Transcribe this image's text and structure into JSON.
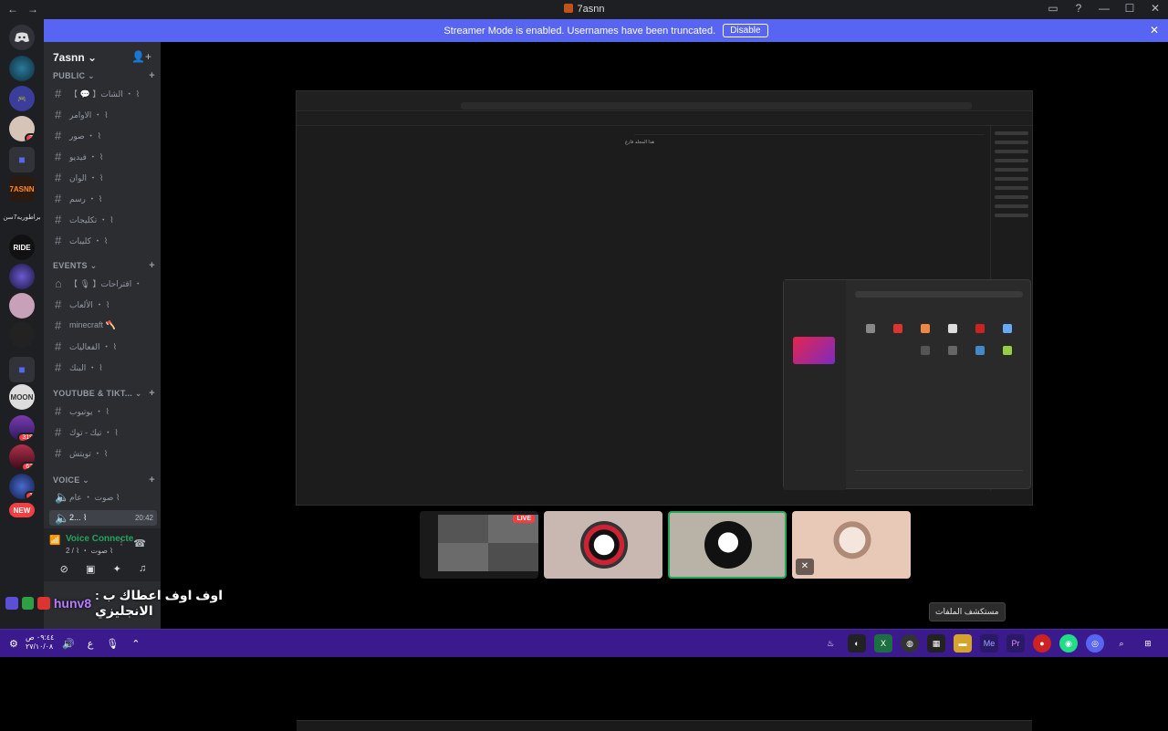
{
  "window": {
    "title": "7asnn",
    "back": "←",
    "forward": "→",
    "help": "?",
    "minimize": "—",
    "maximize": "☐",
    "close": "✕"
  },
  "banner": {
    "text": "Streamer Mode is enabled. Usernames have been truncated.",
    "button": "Disable",
    "close": "✕"
  },
  "guilds": [
    {
      "label": "",
      "badge": ""
    },
    {
      "label": "",
      "badge": ""
    },
    {
      "label": "",
      "badge": "3"
    },
    {
      "label": "",
      "badge": ""
    },
    {
      "label": "7ASNN",
      "badge": ""
    },
    {
      "label": "RIDE",
      "badge": ""
    },
    {
      "label": "",
      "badge": ""
    },
    {
      "label": "",
      "badge": ""
    },
    {
      "label": "",
      "badge": ""
    },
    {
      "label": "MOON",
      "badge": ""
    },
    {
      "label": "",
      "badge": "319"
    },
    {
      "label": "",
      "badge": "62"
    },
    {
      "label": "",
      "badge": "1"
    },
    {
      "label": "NEW",
      "badge": ""
    }
  ],
  "guild_caption": "براطوريه7سن",
  "server": {
    "name": "7asnn ⌄",
    "add_icon": "add-member-icon"
  },
  "categories": {
    "public": "PUBLIC ⌄",
    "events": "EVENTS ⌄",
    "youtube": "YOUTUBE & TIKT... ⌄",
    "voice": "VOICE ⌄"
  },
  "channels": {
    "public": [
      "【 💬 】الشات ・ ⌇",
      "الاوامر ・ ⌇",
      "صور ・ ⌇",
      "فيديو ・ ⌇",
      "الوان ・ ⌇",
      "رسم ・ ⌇",
      "تكليجات ・ ⌇",
      "كليبات ・ ⌇"
    ],
    "events": [
      "【 🎙 】اقتراحات ・",
      "الألعاب ・ ⌇",
      "minecraft 🪓",
      "الفعاليات ・ ⌇",
      "البنك ・ ⌇"
    ],
    "youtube": [
      "يوتيوب ・ ⌇",
      "تيك - توك ・ ⌇",
      "تويتش ・ ⌇"
    ],
    "voice": [
      "صوت ・ عام ⌇",
      "2... ⌇"
    ]
  },
  "voice_active_time": "20:42",
  "voice_panel": {
    "status": "Voice Connecte",
    "sub": "صوت ・ ⌇ / 2 ⌇"
  },
  "screen": {
    "empty_text": "هذا المجلد فارغ"
  },
  "stream": {
    "live": "LIVE"
  },
  "overlay": {
    "name": "hunv8",
    "message": ": اوف اوف اعطاك ب الانجليزي"
  },
  "tooltip": "مستكشف الملفات",
  "taskbar": {
    "time": "٠٩:٤٤ ص",
    "date": "٢٧/١٠/٠٨"
  },
  "colors": {
    "accent": "#5865f2",
    "online": "#23a55a",
    "danger": "#f23f43",
    "taskbar": "#3a1a8c"
  }
}
